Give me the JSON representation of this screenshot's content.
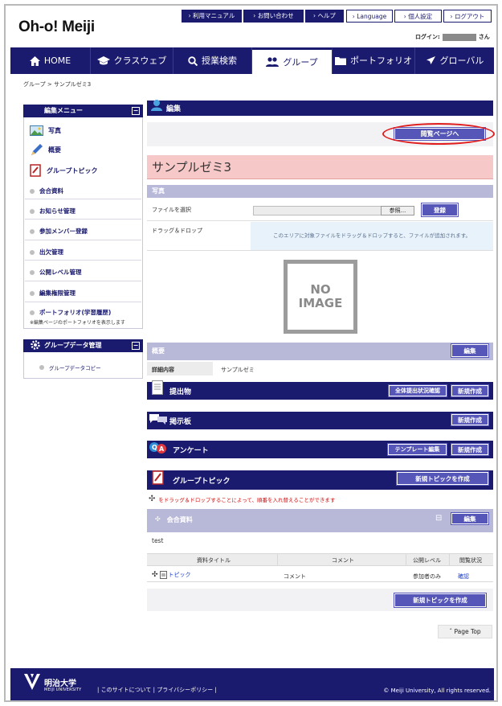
{
  "util_nav": [
    "利用マニュアル",
    "お問い合わせ",
    "ヘルプ",
    "Language",
    "個人設定",
    "ログアウト"
  ],
  "logo": "Oh-o! Meiji",
  "login": {
    "prefix": "ログイン:",
    "suffix": "さん"
  },
  "main_nav": [
    "HOME",
    "クラスウェブ",
    "授業検索",
    "グループ",
    "ポートフォリオ",
    "グローバル"
  ],
  "breadcrumb": {
    "parent": "グループ",
    "sep": ">",
    "current": "サンプルゼミ3"
  },
  "sidebar": {
    "edit_menu_title": "編集メニュー",
    "toggle": "−",
    "items": [
      "写真",
      "概要",
      "グループトピック",
      "会合資料",
      "お知らせ管理",
      "参加メンバー登録",
      "出欠管理",
      "公開レベル管理",
      "編集権限管理",
      "ポートフォリオ(学習履歴)"
    ],
    "portfolio_note": "※編集ページのポートフォリオを表示します",
    "group_data_title": "グループデータ管理",
    "group_data_item": "グループデータコピー"
  },
  "main": {
    "edit_header": "編集",
    "view_page_button": "閲覧ページへ",
    "group_name": "サンプルゼミ3",
    "photo_header": "写真",
    "file_select_label": "ファイルを選択",
    "browse_button": "参照...",
    "register_button": "登録",
    "dragdrop_label": "ドラッグ＆ドロップ",
    "dragdrop_hint": "このエリアに対象ファイルをドラッグ＆ドロップすると、ファイルが追加されます。",
    "no_image": [
      "NO",
      "IMAGE"
    ],
    "overview_header": "概要",
    "edit_button": "編集",
    "detail_label": "詳細内容",
    "detail_value": "サンプルゼミ",
    "submissions": "提出物",
    "submission_status_button": "全体提出状況確認",
    "new_create": "新規作成",
    "bulletin": "掲示板",
    "survey": "アンケート",
    "template_edit_button": "テンプレート編集",
    "group_topic": "グループトピック",
    "new_topic_button": "新規トピックを作成",
    "reorder_hint": "をドラッグ＆ドロップすることによって、順番を入れ替えることができます",
    "meeting_docs": "会合資料",
    "meeting_toggle": "⊟",
    "test_text": "test",
    "table_headers": [
      "資料タイトル",
      "コメント",
      "公開レベル",
      "閲覧状況"
    ],
    "table_row": {
      "title": "トピック",
      "comment": "コメント",
      "level": "参加者のみ",
      "status": "確認"
    },
    "new_topic_bottom": "新規トピックを作成",
    "page_top": "Page Top"
  },
  "footer": {
    "univ_name": "明治大学",
    "univ_en": "MEIJI UNIVERSITY",
    "links": [
      "このサイトについて",
      "プライバシーポリシー"
    ],
    "copyright": "© Meiji University, All rights reserved."
  }
}
